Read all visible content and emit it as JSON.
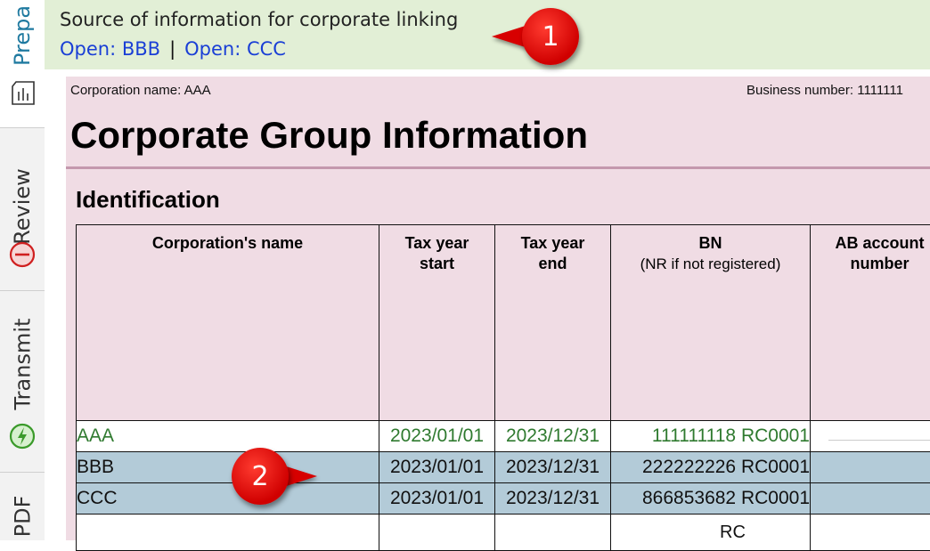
{
  "sidebar": {
    "tabs": [
      {
        "label": "Prepa"
      },
      {
        "label": "Review"
      },
      {
        "label": "Transmit"
      },
      {
        "label": "PDF"
      }
    ]
  },
  "banner": {
    "title": "Source of information for corporate linking",
    "links": [
      "Open: BBB",
      "Open: CCC"
    ],
    "separator": "|"
  },
  "callouts": [
    "1",
    "2"
  ],
  "form": {
    "corporation_name": "Corporation name: AAA",
    "business_number": "Business number: 1111111",
    "title": "Corporate Group Information",
    "section": "Identification",
    "columns": [
      {
        "label": "Corporation's name",
        "sub": ""
      },
      {
        "label": "Tax year start",
        "sub": ""
      },
      {
        "label": "Tax year end",
        "sub": ""
      },
      {
        "label": "BN",
        "sub": "(NR if not registered)"
      },
      {
        "label": "AB account number",
        "sub": ""
      }
    ],
    "rows": [
      {
        "name": "AAA",
        "start": "2023/01/01",
        "end": "2023/12/31",
        "bn": "111111118 RC0001"
      },
      {
        "name": "BBB",
        "start": "2023/01/01",
        "end": "2023/12/31",
        "bn": "222222226 RC0001"
      },
      {
        "name": "CCC",
        "start": "2023/01/01",
        "end": "2023/12/31",
        "bn": "866853682 RC0001"
      }
    ],
    "empty_row_bn": "RC"
  },
  "colors": {
    "banner_bg": "#e2efd6",
    "form_bg": "#f0dce4",
    "linked_row_bg": "#b3cbd8",
    "current_row_text": "#2f7a2f",
    "link": "#1a3fd6",
    "callout": "#d70000"
  }
}
